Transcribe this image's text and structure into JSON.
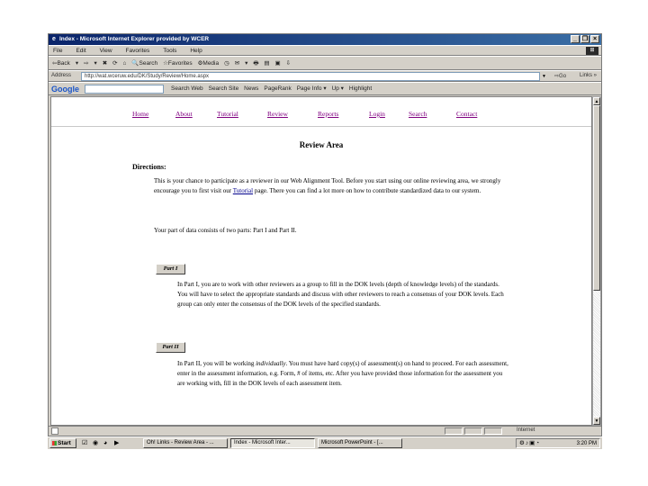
{
  "window": {
    "title": "Index - Microsoft Internet Explorer provided by WCER",
    "controls": [
      "_",
      "❐",
      "×"
    ]
  },
  "menu": [
    "File",
    "Edit",
    "View",
    "Favorites",
    "Tools",
    "Help"
  ],
  "toolbar": {
    "items": [
      "⇦Back",
      "▾",
      "⇨",
      "▾",
      "✖",
      "⟳",
      "⌂",
      "🔍Search",
      "☆Favorites",
      "⚙Media",
      "◷",
      "✉",
      "▾",
      "🖶",
      "▤",
      "▣",
      "⇩"
    ]
  },
  "address": {
    "label": "Address",
    "url": "http://wat.wceruw.edu/DK/Study/Review/Home.aspx",
    "go_label": "⇨Go",
    "links_label": "Links »"
  },
  "google_bar": {
    "logo": "Google",
    "search_value": "",
    "items": [
      "Search Web",
      "Search Site",
      "News",
      "PageRank",
      "Page Info ▾",
      "Up ▾",
      "Highlight"
    ]
  },
  "page": {
    "nav": [
      "Home",
      "About",
      "Tutorial",
      "Review",
      "Reports",
      "Login",
      "Search",
      "Contact"
    ],
    "heading": "Review Area",
    "directions_label": "Directions:",
    "intro_pre": "This is your chance to participate as a reviewer in our Web Alignment Tool. Before you start using our online reviewing area, we strongly encourage you to first visit our ",
    "intro_link": "Tutorial",
    "intro_post": " page. There you can find a lot more on how to contribute standardized data to our system.",
    "parts_text": "Your part of data consists of two parts: Part I and Part II.",
    "part1": {
      "button": "Part I",
      "text": "In Part I, you are to work with other reviewers as a group to fill in the DOK levels (depth of knowledge levels) of the standards. You will have to select the appropriate standards and discuss with other reviewers to reach a consensus of your DOK levels. Each group can only enter the consensus of the DOK levels of the specified standards."
    },
    "part2": {
      "button": "Part II",
      "text_pre": "In Part II, you will be working ",
      "text_em": "individually",
      "text_post": ". You must have hard copy(s) of assessment(s) on hand to proceed. For each assessment, enter in the assessment information, e.g. Form, # of items, etc. After you have provided those information for the assessment you are working with, fill in the DOK levels of each assessment item."
    }
  },
  "status": {
    "zone": "Internet"
  },
  "taskbar": {
    "start": "Start",
    "quicklaunch": [
      "☑",
      "◉",
      "◕",
      "▶"
    ],
    "tasks": [
      {
        "label": "Oh! Links - Review Area - ...",
        "active": false
      },
      {
        "label": "Index - Microsoft Inter...",
        "active": true
      },
      {
        "label": "Microsoft PowerPoint - [...",
        "active": false
      }
    ],
    "tray_icons": "⚙♪▣◔",
    "clock": "3:20 PM"
  }
}
